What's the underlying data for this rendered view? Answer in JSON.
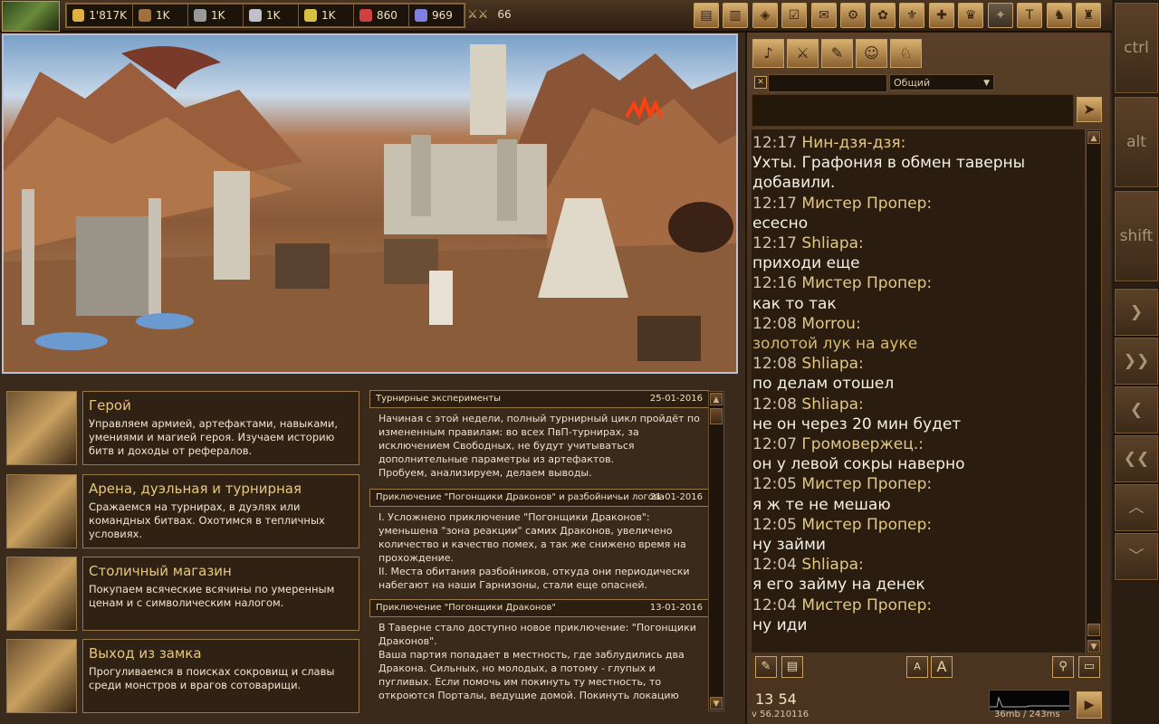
{
  "resources": [
    {
      "name": "gold-icon",
      "value": "1'817K",
      "color": "#e0b040"
    },
    {
      "name": "wood-icon",
      "value": "1K",
      "color": "#a07040"
    },
    {
      "name": "ore-icon",
      "value": "1K",
      "color": "#9a9a9a"
    },
    {
      "name": "mercury-icon",
      "value": "1K",
      "color": "#c0c0c8"
    },
    {
      "name": "sulfur-icon",
      "value": "1K",
      "color": "#d8c040"
    },
    {
      "name": "crystal-icon",
      "value": "860",
      "color": "#d04040"
    },
    {
      "name": "gems-icon",
      "value": "969",
      "color": "#8080e0"
    }
  ],
  "army": {
    "value": "66"
  },
  "modifiers": {
    "ctrl": "ctrl",
    "alt": "alt",
    "shift": "shift"
  },
  "menu": [
    {
      "title": "Герой",
      "desc": "Управляем армией, артефактами, навыками, умениями и магией героя. Изучаем историю битв и доходы от рефералов."
    },
    {
      "title": "Арена, дуэльная и турнирная",
      "desc": "Сражаемся на турнирах, в дуэлях или командных битвах. Охотимся в тепличных условиях."
    },
    {
      "title": "Столичный магазин",
      "desc": "Покупаем всяческие всячины по умеренным ценам и с символическим налогом."
    },
    {
      "title": "Выход из замка",
      "desc": "Прогуливаемся в поисках сокровищ и славы среди монстров и врагов сотоварищи."
    }
  ],
  "news": [
    {
      "title": "Турнирные эксперименты",
      "date": "25-01-2016",
      "body": [
        "Начиная с этой недели, полный турнирный цикл пройдёт по измененным правилам: во всех ПвП-турнирах, за исключением Свободных, не будут учитываться дополнительные параметры из артефактов.",
        "Пробуем, анализируем, делаем выводы."
      ]
    },
    {
      "title": "Приключение \"Погонщики Драконов\" и разбойничьи логова",
      "date": "21-01-2016",
      "body": [
        "I. Усложнено приключение \"Погонщики Драконов\": уменьшена \"зона реакции\" самих Драконов, увеличено количество и качество помех, а так же снижено время на прохождение.",
        "II. Места обитания разбойников, откуда они периодически набегают на наши Гарнизоны, стали еще опасней."
      ]
    },
    {
      "title": "Приключение \"Погонщики Драконов\"",
      "date": "13-01-2016",
      "body": [
        "В Таверне стало доступно новое приключение: \"Погонщики Драконов\".",
        "Ваша партия попадает в местность, где заблудились два Дракона. Сильных, но молодых, а потому - глупых и пугливых. Если помочь им покинуть ту местность, то откроются Порталы, ведущие домой. Покинуть локацию"
      ]
    }
  ],
  "chat": {
    "channel": "Общий",
    "messages": [
      {
        "time": "12:17",
        "nick": "Нин-дзя-дзя:",
        "text": "Ухты. Графония в обмен таверны добавили.",
        "gold": false
      },
      {
        "time": "12:17",
        "nick": "Мистер Пропер:",
        "text": "есесно",
        "gold": false
      },
      {
        "time": "12:17",
        "nick": "Shliapa:",
        "text": "приходи еще",
        "gold": false
      },
      {
        "time": "12:16",
        "nick": "Мистер Пропер:",
        "text": "как то так",
        "gold": false
      },
      {
        "time": "12:08",
        "nick": "Morrou:",
        "text": "золотой лук на ауке",
        "gold": true
      },
      {
        "time": "12:08",
        "nick": "Shliapa:",
        "text": "по делам отошел",
        "gold": false
      },
      {
        "time": "12:08",
        "nick": "Shliapa:",
        "text": "не он через 20 мин будет",
        "gold": false
      },
      {
        "time": "12:07",
        "nick": "Громовержец.:",
        "text": "он у левой сокры наверно",
        "gold": false
      },
      {
        "time": "12:05",
        "nick": "Мистер Пропер:",
        "text": "я ж те не мешаю",
        "gold": false
      },
      {
        "time": "12:05",
        "nick": "Мистер Пропер:",
        "text": "ну займи",
        "gold": false
      },
      {
        "time": "12:04",
        "nick": "Shliapa:",
        "text": "я его займу на денек",
        "gold": false
      },
      {
        "time": "12:04",
        "nick": "Мистер Пропер:",
        "text": "ну иди",
        "gold": false
      }
    ],
    "font_small": "A",
    "font_large": "A"
  },
  "status": {
    "clock": "13 54",
    "version": "v 56.210116",
    "net": "36mb / 243ms"
  }
}
